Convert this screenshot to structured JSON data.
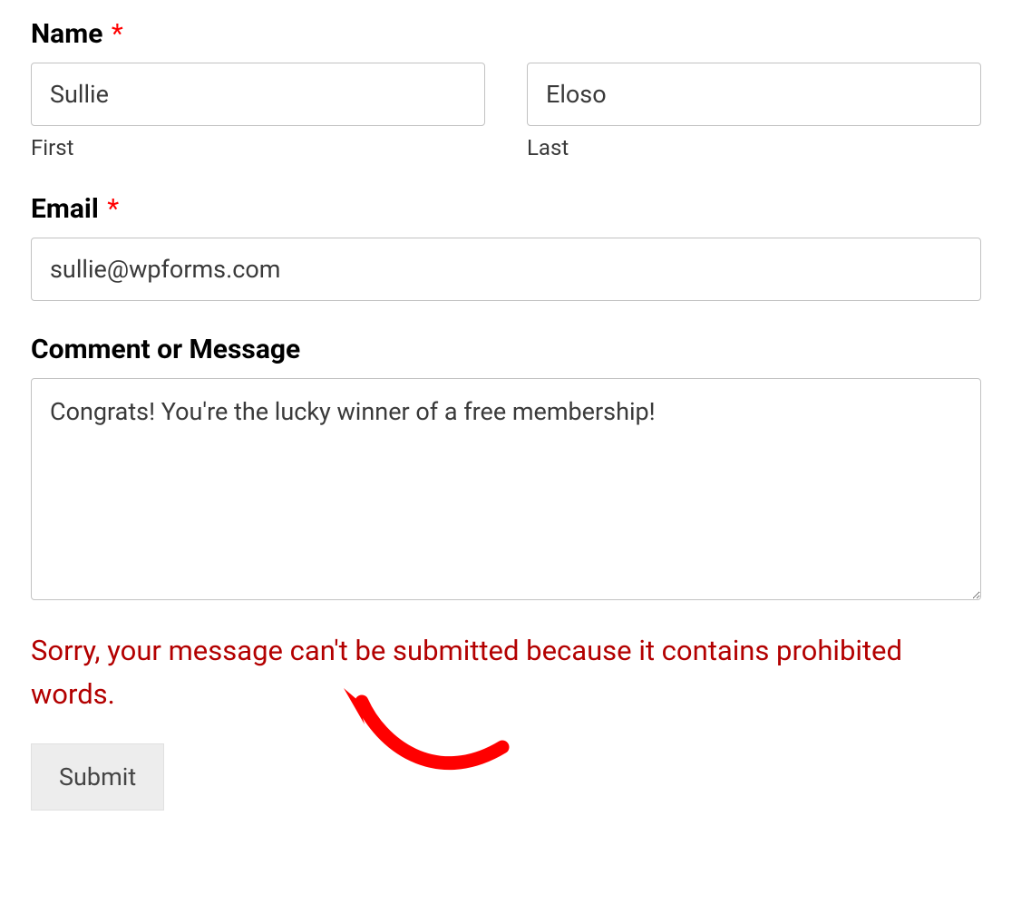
{
  "form": {
    "name": {
      "label": "Name",
      "required_marker": "*",
      "first": {
        "value": "Sullie",
        "sublabel": "First"
      },
      "last": {
        "value": "Eloso",
        "sublabel": "Last"
      }
    },
    "email": {
      "label": "Email",
      "required_marker": "*",
      "value": "sullie@wpforms.com"
    },
    "comment": {
      "label": "Comment or Message",
      "value": "Congrats! You're the lucky winner of a free membership!"
    },
    "error": "Sorry, your message can't be submitted because it contains prohibited words.",
    "submit": {
      "label": "Submit"
    }
  }
}
